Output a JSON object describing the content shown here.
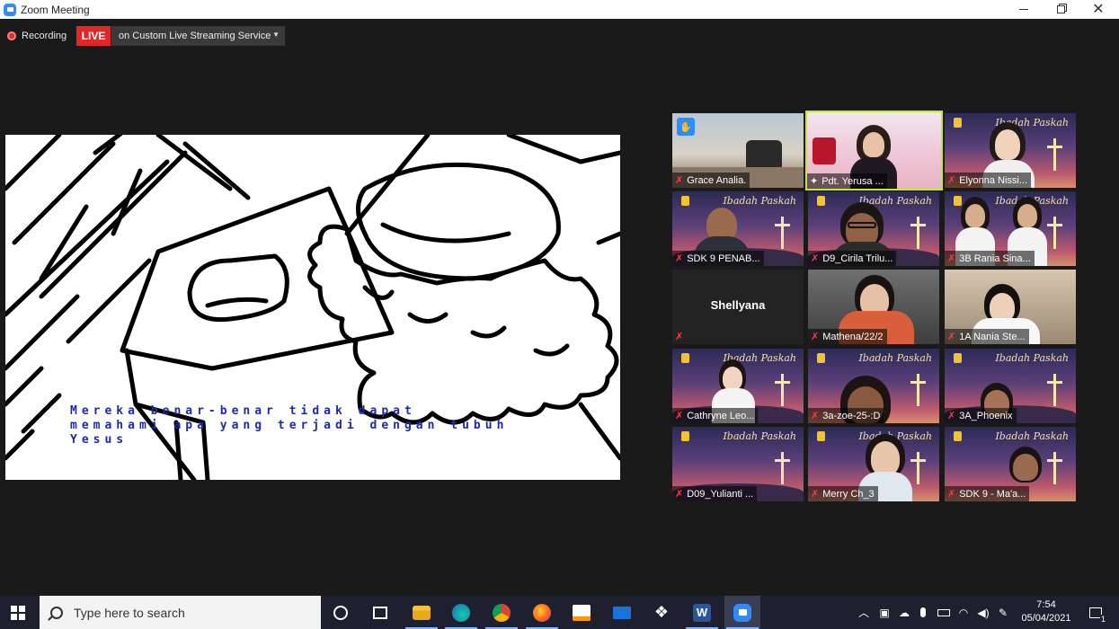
{
  "window": {
    "title": "Zoom Meeting"
  },
  "meeting_bar": {
    "recording_label": "Recording",
    "live_label": "LIVE",
    "streaming_label": "on Custom Live Streaming Service"
  },
  "share": {
    "caption_line1": "Mereka benar-benar tidak dapat",
    "caption_line2": "memahami apa yang terjadi dengan tubuh",
    "caption_line3": "Yesus"
  },
  "poster": {
    "title": "Ibadah Paskah"
  },
  "participants": [
    {
      "name": "Grace Analia."
    },
    {
      "name": "Pdt. Yerusa ..."
    },
    {
      "name": "Elyonna Nissi..."
    },
    {
      "name": "SDK 9 PENAB..."
    },
    {
      "name": "D9_Cirila Trilu..."
    },
    {
      "name": "3B Rania Sina..."
    },
    {
      "name": "Shellyana"
    },
    {
      "name": "Mathena/22/2"
    },
    {
      "name": "1A Nania Ste..."
    },
    {
      "name": "Cathryne Leo..."
    },
    {
      "name": "3a-zoe-25-:D"
    },
    {
      "name": "3A_Phoenix"
    },
    {
      "name": "D09_Yulianti ..."
    },
    {
      "name": "Merry Ch_3"
    },
    {
      "name": "SDK 9 - Ma'a..."
    }
  ],
  "taskbar": {
    "search_placeholder": "Type here to search",
    "time": "7:54",
    "date": "05/04/2021",
    "notification_count": "1"
  },
  "colors": {
    "live": "#e02828",
    "active_speaker": "#c4e63a",
    "zoom_blue": "#2d8cff"
  }
}
